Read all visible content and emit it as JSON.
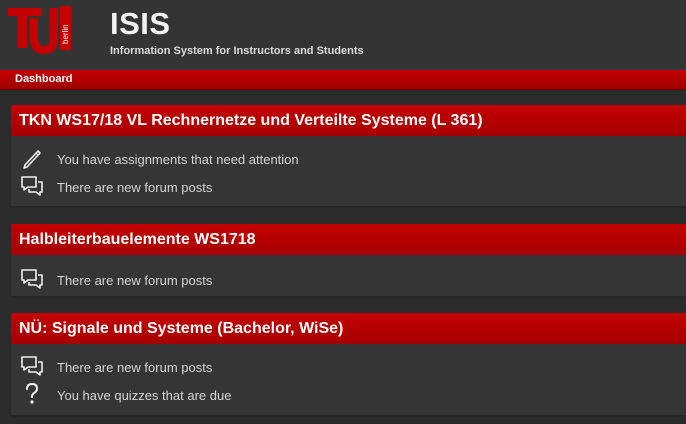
{
  "header": {
    "logo_text": "berlin",
    "title": "ISIS",
    "subtitle": "Information System for Instructors and Students"
  },
  "nav": {
    "dashboard": "Dashboard"
  },
  "courses": [
    {
      "title": "TKN WS17/18 VL Rechnernetze und Verteilte Systeme (L 361)",
      "notifications": [
        {
          "icon": "pencil-icon",
          "text": "You have assignments that need attention"
        },
        {
          "icon": "forum-icon",
          "text": "There are new forum posts"
        }
      ]
    },
    {
      "title": "Halbleiterbauelemente WS1718",
      "notifications": [
        {
          "icon": "forum-icon",
          "text": "There are new forum posts"
        }
      ]
    },
    {
      "title": "NÜ: Signale und Systeme (Bachelor, WiSe)",
      "notifications": [
        {
          "icon": "forum-icon",
          "text": "There are new forum posts"
        },
        {
          "icon": "question-icon",
          "text": "You have quizzes that are due"
        }
      ]
    }
  ],
  "colors": {
    "brand_red": "#c40000",
    "background": "#2b2b2b",
    "panel": "#353535"
  }
}
